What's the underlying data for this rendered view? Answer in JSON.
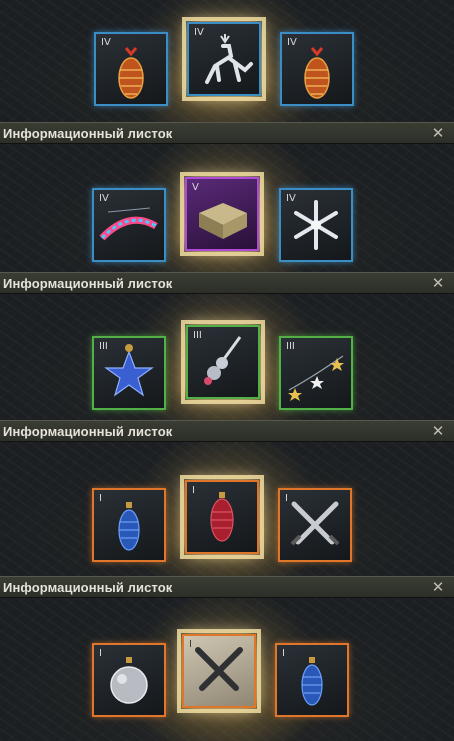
{
  "panels": [
    {
      "title": "Информационный листок",
      "close_icon": "close-icon",
      "cards": [
        {
          "tier": "IV",
          "item": "pinecone-ornament-icon",
          "rarity": "IV",
          "color": "#3a8ec4"
        },
        {
          "tier": "IV",
          "item": "reindeer-ornament-icon",
          "rarity": "IV",
          "color": "#3a8ec4",
          "selected": true
        },
        {
          "tier": "IV",
          "item": "pinecone-ornament-icon",
          "rarity": "IV",
          "color": "#3a8ec4"
        }
      ]
    },
    {
      "title": "Информационный листок",
      "close_icon": "close-icon",
      "cards": [
        {
          "tier": "IV",
          "item": "happy-new-year-garland-icon",
          "rarity": "IV",
          "color": "#3a8ec4"
        },
        {
          "tier": "V",
          "item": "gift-box-icon",
          "rarity": "V",
          "color": "#b04ad8",
          "selected": true
        },
        {
          "tier": "IV",
          "item": "snowflake-icon",
          "rarity": "IV",
          "color": "#3a8ec4"
        }
      ]
    },
    {
      "title": "Информационный листок",
      "close_icon": "close-icon",
      "cards": [
        {
          "tier": "III",
          "item": "blue-star-ornament-icon",
          "rarity": "III",
          "color": "#52b046"
        },
        {
          "tier": "III",
          "item": "tree-topper-icon",
          "rarity": "III",
          "color": "#52b046",
          "selected": true
        },
        {
          "tier": "III",
          "item": "star-garland-icon",
          "rarity": "III",
          "color": "#52b046"
        }
      ]
    },
    {
      "title": "Информационный листок",
      "close_icon": "close-icon",
      "cards": [
        {
          "tier": "I",
          "item": "blue-pinecone-ornament-icon",
          "rarity": "I",
          "color": "#e0762a"
        },
        {
          "tier": "I",
          "item": "red-pinecone-ornament-icon",
          "rarity": "I",
          "color": "#e0762a",
          "selected": true
        },
        {
          "tier": "I",
          "item": "crossed-swords-icon",
          "rarity": "I",
          "color": "#e0762a"
        }
      ]
    },
    {
      "cards": [
        {
          "tier": "I",
          "item": "silver-ball-ornament-icon",
          "rarity": "I",
          "color": "#e0762a"
        },
        {
          "tier": "I",
          "item": "crossed-swords-icon",
          "rarity": "I",
          "color": "#e0762a",
          "selected": true
        },
        {
          "tier": "I",
          "item": "blue-pinecone-ornament-icon",
          "rarity": "I",
          "color": "#e0762a"
        }
      ]
    }
  ]
}
